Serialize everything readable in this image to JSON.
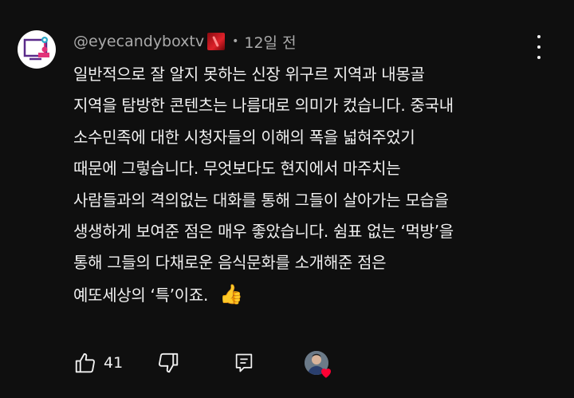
{
  "comment": {
    "author_handle": "@eyecandyboxtv",
    "separator": "•",
    "timestamp": "12일 전",
    "lines": [
      "일반적으로 잘 알지 못하는 신장 위구르 지역과 내몽골",
      "지역을 탐방한 콘텐츠는 나름대로 의미가 컸습니다. 중국내",
      "소수민족에 대한 시청자들의 이해의 폭을 넓혀주었기",
      "때문에 그렇습니다. 무엇보다도 현지에서 마주치는",
      "사람들과의 격의없는 대화를 통해 그들이 살아가는 모습을",
      "생생하게 보여준 점은 매우 좋았습니다. 쉼표 없는 ‘먹방’을",
      "통해 그들의 다채로운 음식문화를 소개해준 점은",
      "예또세상의 ‘특’이죠."
    ],
    "emoji": "👍",
    "like_count": "41"
  },
  "icons": {
    "kebab": "more-vert-icon",
    "like": "thumb-up-icon",
    "dislike": "thumb-down-icon",
    "reply": "comment-icon",
    "creator_heart": "creator-heart-icon"
  },
  "colors": {
    "background": "#0f0f0f",
    "text": "#f1f1f1",
    "meta": "#aaaaaa",
    "heart": "#ff0033"
  }
}
